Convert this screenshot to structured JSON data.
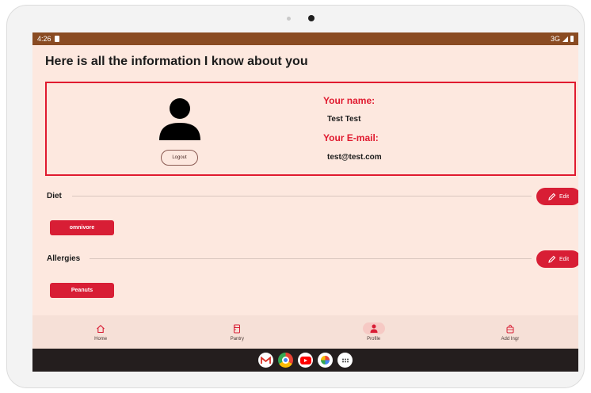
{
  "status_bar": {
    "time": "4:26",
    "network": "3G"
  },
  "page": {
    "title": "Here is all the information I know about you"
  },
  "profile": {
    "logout_label": "Logout",
    "name_label": "Your name:",
    "name_value": "Test Test",
    "email_label": "Your E-mail:",
    "email_value": "test@test.com"
  },
  "diet": {
    "title": "Diet",
    "edit_label": "Edit",
    "items": [
      "omnivore"
    ]
  },
  "allergies": {
    "title": "Allergies",
    "edit_label": "Edit",
    "items": [
      "Peanuts"
    ]
  },
  "bottom_nav": {
    "items": [
      {
        "label": "Home",
        "icon": "home-icon"
      },
      {
        "label": "Pantry",
        "icon": "fridge-icon"
      },
      {
        "label": "Profile",
        "icon": "person-icon",
        "active": true
      },
      {
        "label": "Add Ingr",
        "icon": "add-ingredient-icon"
      }
    ]
  },
  "system_apps": [
    "gmail-icon",
    "chrome-icon",
    "youtube-icon",
    "photos-icon",
    "app-drawer-icon"
  ],
  "colors": {
    "accent": "#d81e35",
    "background": "#fde8df",
    "status_bar": "#8a4b22",
    "system_bar": "#241e1e"
  }
}
